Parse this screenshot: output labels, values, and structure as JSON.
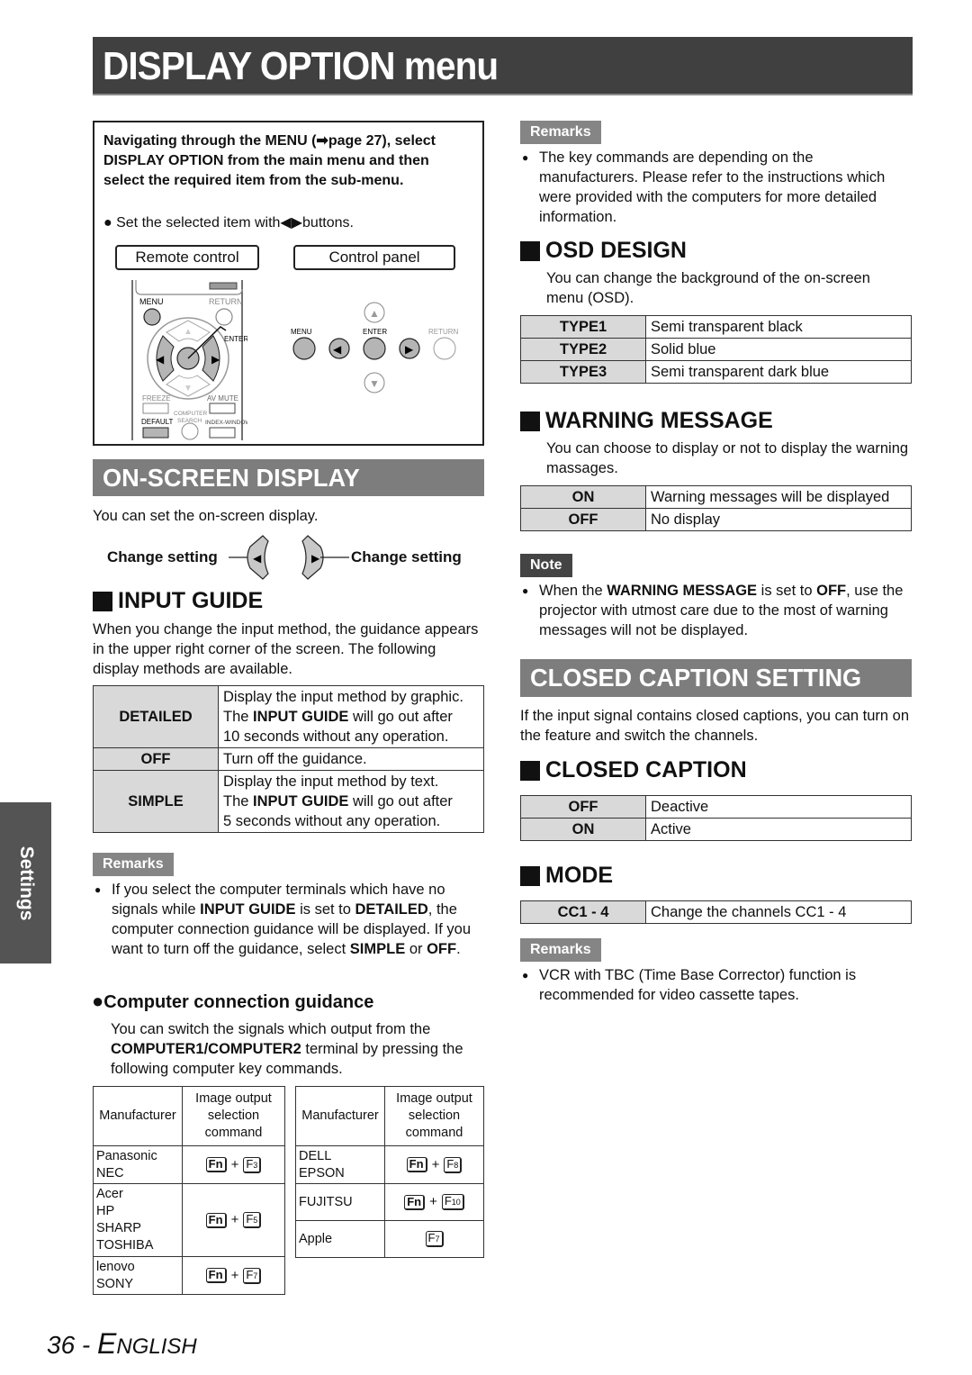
{
  "page_title": "DISPLAY OPTION menu",
  "side_tab": "Settings",
  "footer": {
    "page_number": "36",
    "separator": " - ",
    "language_first": "E",
    "language_rest": "NGLISH"
  },
  "nav_box": {
    "instruction": "Navigating through the MENU (➡page 27), select DISPLAY OPTION from the main menu and then select the required item from the sub-menu.",
    "bullet": "Set the selected item with◀▶buttons.",
    "remote_label": "Remote control",
    "panel_label": "Control panel",
    "remote_buttons": {
      "menu": "MENU",
      "return": "RETURN",
      "enter": "ENTER",
      "freeze": "FREEZE",
      "av_mute": "AV MUTE",
      "computer_search": "COMPUTER SEARCH",
      "default": "DEFAULT",
      "index_window": "INDEX-WINDOW"
    },
    "panel_buttons": {
      "menu": "MENU",
      "enter": "ENTER",
      "return": "RETURN"
    }
  },
  "on_screen_display": {
    "heading": "ON-SCREEN DISPLAY",
    "intro": "You can set the on-screen display.",
    "change_left": "Change setting",
    "change_right": "Change setting"
  },
  "input_guide": {
    "heading": "INPUT GUIDE",
    "intro": "When you change the input method, the guidance appears in the upper right corner of the screen. The following display methods are available.",
    "rows": [
      {
        "key": "DETAILED",
        "line1": "Display the input method by graphic.",
        "pre": "The ",
        "bold": "INPUT GUIDE",
        "post": " will go out after",
        "line3": "10 seconds without any operation."
      },
      {
        "key": "OFF",
        "line1": "Turn off the guidance."
      },
      {
        "key": "SIMPLE",
        "line1": "Display the input method by text.",
        "pre": "The ",
        "bold": "INPUT GUIDE",
        "post": " will go out after",
        "line3": "5 seconds without any operation."
      }
    ],
    "remarks_label": "Remarks",
    "remark": {
      "t1": "If you select the computer terminals which have no signals while ",
      "b1": "INPUT GUIDE",
      "t2": " is set to ",
      "b2": "DETAILED",
      "t3": ", the computer connection guidance will be displayed. If you want to turn off the guidance, select ",
      "b3": "SIMPLE",
      "t4": " or ",
      "b4": "OFF",
      "t5": "."
    }
  },
  "computer_guidance": {
    "heading": "Computer connection guidance",
    "t1": "You can switch the signals which output from the ",
    "b1": "COMPUTER1/COMPUTER2",
    "t2": " terminal by pressing the following computer key commands.",
    "header_manufacturer": "Manufacturer",
    "header_command": "Image output selection command",
    "left_table": [
      {
        "makers": [
          "Panasonic",
          "NEC"
        ],
        "fn": "Fn",
        "key": "F3"
      },
      {
        "makers": [
          "Acer",
          "HP",
          "SHARP",
          "TOSHIBA"
        ],
        "fn": "Fn",
        "key": "F5"
      },
      {
        "makers": [
          "lenovo",
          "SONY"
        ],
        "fn": "Fn",
        "key": "F7"
      }
    ],
    "right_table": [
      {
        "makers": [
          "DELL",
          "EPSON"
        ],
        "fn": "Fn",
        "key": "F8"
      },
      {
        "makers": [
          "FUJITSU"
        ],
        "fn": "Fn",
        "key": "F10"
      },
      {
        "makers": [
          "Apple"
        ],
        "fn": "",
        "key": "F7"
      }
    ]
  },
  "right_remarks": {
    "label": "Remarks",
    "text": "The key commands are depending on the manufacturers. Please refer to the instructions which were provided with the computers for more detailed information."
  },
  "osd_design": {
    "heading": "OSD DESIGN",
    "intro": "You can change the background of the on-screen menu (OSD).",
    "rows": [
      {
        "key": "TYPE1",
        "value": "Semi transparent black"
      },
      {
        "key": "TYPE2",
        "value": "Solid blue"
      },
      {
        "key": "TYPE3",
        "value": "Semi transparent dark blue"
      }
    ]
  },
  "warning_message": {
    "heading": "WARNING MESSAGE",
    "intro": "You can choose to display or not to display the warning massages.",
    "rows": [
      {
        "key": "ON",
        "value": "Warning messages will be displayed"
      },
      {
        "key": "OFF",
        "value": "No display"
      }
    ],
    "note_label": "Note",
    "note": {
      "t1": "When the ",
      "b1": "WARNING MESSAGE",
      "t2": " is set to ",
      "b2": "OFF",
      "t3": ", use the projector with utmost care due to the most of warning messages will not be displayed."
    }
  },
  "closed_caption_setting": {
    "heading": "CLOSED CAPTION SETTING",
    "intro": "If the input signal contains closed captions, you can turn on the feature and switch the channels.",
    "cc_heading": "CLOSED CAPTION",
    "cc_rows": [
      {
        "key": "OFF",
        "value": "Deactive"
      },
      {
        "key": "ON",
        "value": "Active"
      }
    ],
    "mode_heading": "MODE",
    "mode_rows": [
      {
        "key": "CC1 - 4",
        "value": "Change the channels CC1 - 4"
      }
    ],
    "remarks_label": "Remarks",
    "remark": "VCR with TBC (Time Base Corrector) function is recommended for video cassette tapes."
  },
  "colors": {
    "title_bar": "#404040",
    "band": "#7d7d7d",
    "remarks_tag": "#858585",
    "note_tag": "#444444",
    "table_key_bg": "#d9d9d9",
    "side_tab": "#545454"
  }
}
